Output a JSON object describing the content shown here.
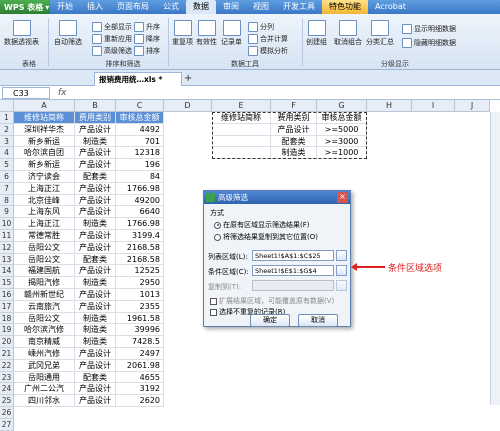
{
  "app": {
    "name": "WPS 表格"
  },
  "menu": [
    "开始",
    "插入",
    "页面布局",
    "公式",
    "数据",
    "审阅",
    "视图",
    "开发工具",
    "特色功能",
    "Acrobat"
  ],
  "active_menu": "数据",
  "ribbon": {
    "pivot": "数据透视表",
    "autofilter": "自动筛选",
    "show_all": "全部显示",
    "reapply": "重新应用",
    "advanced": "高级筛选",
    "sort_asc": "升序",
    "sort_desc": "降序",
    "sort": "排序",
    "dup": "重复项",
    "validity": "有效性",
    "record": "记录单",
    "split": "分列",
    "merge": "合并计算",
    "whatif": "模拟分析",
    "group": "创建组",
    "ungroup": "取消组合",
    "subtotal": "分类汇总",
    "show_detail": "显示明细数据",
    "hide_detail": "隐藏明细数据",
    "grp_table": "表格",
    "grp_sortfilter": "排序和筛选",
    "grp_datatools": "数据工具",
    "grp_outline": "分级显示"
  },
  "doc_tab": "报销费用统…xls *",
  "name_box": "C33",
  "columns": [
    "A",
    "B",
    "C",
    "D",
    "E",
    "F",
    "G",
    "H",
    "I",
    "J"
  ],
  "rows": [
    "1",
    "2",
    "3",
    "4",
    "5",
    "6",
    "7",
    "8",
    "9",
    "10",
    "11",
    "12",
    "13",
    "14",
    "15",
    "16",
    "17",
    "18",
    "19",
    "20",
    "21",
    "22",
    "23",
    "24",
    "25",
    "26",
    "27"
  ],
  "table": {
    "headers": [
      "维修站简称",
      "费用类别",
      "审核总金额"
    ],
    "data": [
      [
        "深圳祥华杰",
        "产品设计",
        "4492"
      ],
      [
        "新乡新运",
        "制造类",
        "701"
      ],
      [
        "哈尔滨自团",
        "产品设计",
        "12318"
      ],
      [
        "新乡新运",
        "产品设计",
        "196"
      ],
      [
        "济宁读会",
        "配套类",
        "84"
      ],
      [
        "上海正江",
        "产品设计",
        "1766.98"
      ],
      [
        "北京佳峰",
        "产品设计",
        "49200"
      ],
      [
        "上海东风",
        "产品设计",
        "6640"
      ],
      [
        "上海正江",
        "制造类",
        "1766.98"
      ],
      [
        "常德常胜",
        "产品设计",
        "3199.4"
      ],
      [
        "岳阳公文",
        "产品设计",
        "2168.58"
      ],
      [
        "岳阳公文",
        "配套类",
        "2168.58"
      ],
      [
        "福建国航",
        "产品设计",
        "12525"
      ],
      [
        "揭阳汽修",
        "制造类",
        "2950"
      ],
      [
        "赣州新世纪",
        "产品设计",
        "1013"
      ],
      [
        "云南旅汽",
        "产品设计",
        "2355"
      ],
      [
        "岳阳公文",
        "制造类",
        "1961.58"
      ],
      [
        "哈尔滨汽修",
        "制造类",
        "39996"
      ],
      [
        "南京精威",
        "制造类",
        "7428.5"
      ],
      [
        "嵊州汽修",
        "产品设计",
        "2497"
      ],
      [
        "武冈兄弟",
        "产品设计",
        "2061.98"
      ],
      [
        "岳阳通用",
        "配套类",
        "4655"
      ],
      [
        "广州二公汽",
        "产品设计",
        "3192"
      ],
      [
        "四川邻水",
        "产品设计",
        "2620"
      ]
    ]
  },
  "criteria": {
    "headers": [
      "维修站简称",
      "费用类别",
      "审核总金额"
    ],
    "rows": [
      [
        "",
        "产品设计",
        ">=5000"
      ],
      [
        "",
        "配套类",
        ">=3000"
      ],
      [
        "",
        "制造类",
        ">=1000"
      ]
    ]
  },
  "dialog": {
    "title": "高级筛选",
    "section": "方式",
    "opt1": "在原有区域显示筛选结果(F)",
    "opt2": "将筛选结果复制到其它位置(O)",
    "list_label": "列表区域(L):",
    "list_value": "Sheet1!$A$1:$C$25",
    "criteria_label": "条件区域(C):",
    "criteria_value": "Sheet1!$E$1:$G$4",
    "copyto_label": "复制到(T):",
    "expand": "扩展结果区域，可能覆盖原有数据(V)",
    "unique": "选择不重复的记录(R)",
    "ok": "确定",
    "cancel": "取消"
  },
  "annotation": "条件区域选项",
  "colors": {
    "accent": "#3a78c8",
    "header_fill": "#5b8fd6",
    "arrow": "#e02020"
  }
}
